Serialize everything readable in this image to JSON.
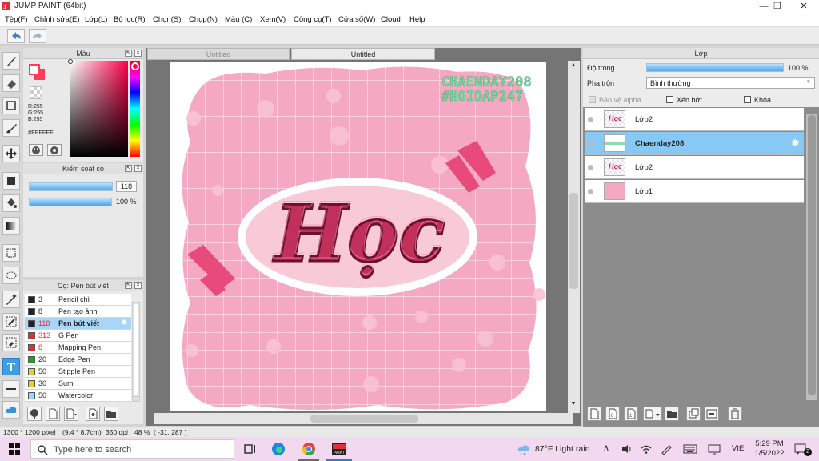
{
  "window": {
    "title": "JUMP PAINT (64bit)",
    "minimize": "—",
    "maximize": "❐",
    "close": "✕"
  },
  "menu": [
    "Tệp(F)",
    "Chỉnh sửa(E)",
    "Lớp(L)",
    "Bộ lọc(R)",
    "Chọn(S)",
    "Chụp(N)",
    "Màu (C)",
    "Xem(V)",
    "Công cụ(T)",
    "Cửa sổ(W)",
    "Cloud",
    "Help"
  ],
  "color_panel": {
    "title": "Màu",
    "r": "R:255",
    "g": "G:255",
    "b": "B:255",
    "hex": "#FFFFFF",
    "primary_color": "#ff3b5c",
    "secondary_color": "#ffffff"
  },
  "brush_control": {
    "title": "Kiểm soát cọ",
    "size": "118",
    "opacity": "100 %",
    "size_fraction": 0.9,
    "opacity_fraction": 1.0
  },
  "pen_panel": {
    "title": "Cọ: Pen bút viết",
    "items": [
      {
        "size": "3",
        "name": "Pencil chì",
        "color": "#222222"
      },
      {
        "size": "8",
        "name": "Pen tạo ảnh",
        "color": "#222222"
      },
      {
        "size": "118",
        "name": "Pen bút viết",
        "color": "#222222",
        "selected": true
      },
      {
        "size": "313",
        "name": "G Pen",
        "color": "#e03030"
      },
      {
        "size": "8",
        "name": "Mapping Pen",
        "color": "#e03030"
      },
      {
        "size": "20",
        "name": "Edge Pen",
        "color": "#1ea31e"
      },
      {
        "size": "50",
        "name": "Stipple Pen",
        "color": "#e6d21e"
      },
      {
        "size": "30",
        "name": "Sumi",
        "color": "#e6d21e"
      },
      {
        "size": "50",
        "name": "Watercolor",
        "color": "#8fd8ff"
      }
    ]
  },
  "doc_tabs": [
    "Untitled",
    "Untitled"
  ],
  "artwork": {
    "line1": "CHAENDAY208",
    "line2": "#HOIDAP247",
    "lettering": "Học"
  },
  "layer_panel": {
    "title": "Lớp",
    "opacity_label": "Độ trong",
    "opacity_value": "100 %",
    "blend_label": "Pha trộn",
    "blend_value": "Bình thường",
    "protect_alpha": "Bảo vệ alpha",
    "clipping": "Xén bớt",
    "lock": "Khóa",
    "layers": [
      {
        "name": "Lớp2",
        "selected": false
      },
      {
        "name": "Chaenday208",
        "selected": true
      },
      {
        "name": "Lớp2",
        "selected": false
      },
      {
        "name": "Lớp1",
        "selected": false
      }
    ]
  },
  "status": {
    "size": "1300 * 1200 pixel",
    "dims": "(9.4 * 8.7cm)",
    "dpi": "350 dpi",
    "zoom": "48 %",
    "coords": "( -31, 287 )"
  },
  "taskbar": {
    "search_placeholder": "Type here to search",
    "weather": "87°F  Light rain",
    "lang": "VIE",
    "time": "5:29 PM",
    "date": "1/5/2022",
    "notifications": "2"
  }
}
